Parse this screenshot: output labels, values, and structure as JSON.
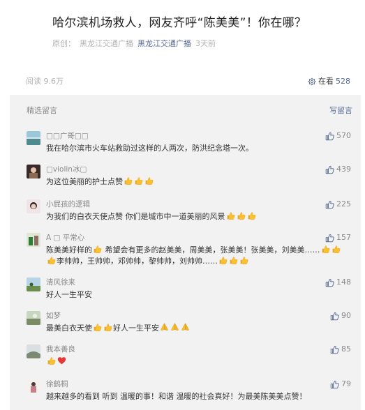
{
  "article": {
    "title": "哈尔滨机场救人，网友齐呼“陈美美”！你在哪？",
    "origin_label": "原创：",
    "author": "黑龙江交通广播",
    "account": "黑龙江交通广播",
    "time": "3天前"
  },
  "stats": {
    "read": "阅读  9.6万",
    "look_label": "在看",
    "look_count": "528"
  },
  "comments_section": {
    "title": "精选留言",
    "write": "写留言"
  },
  "comments": [
    {
      "nick": "□□广哥□□",
      "text": "我在哈尔滨市火车站救助过这样的人两次，防洪纪念塔一次。",
      "likes": "570"
    },
    {
      "nick": "□violin冰□",
      "text": "为这位美丽的护士点赞",
      "likes": "439"
    },
    {
      "nick": "小屁孩的逻辑",
      "text": "为我们的白衣天使点赞 你们是城市中一道美丽的风景",
      "likes": "225"
    },
    {
      "nick": "A □ 平常心",
      "text1": "陈美美好样的",
      "text2": " 希望会有更多的赵美美，周美美，张美美！张美美，刘美美……",
      "text3": "李帅帅，王帅帅，邓帅帅，黎帅帅，刘帅帅……",
      "likes": "157"
    },
    {
      "nick": "清风徐来",
      "text": "好人一生平安",
      "likes": "148"
    },
    {
      "nick": "如梦",
      "text1": "最美白衣天使",
      "text2": "好人一生平安",
      "likes": "90"
    },
    {
      "nick": "我本善良",
      "text": "",
      "likes": "85"
    },
    {
      "nick": "徐鹤桐",
      "text": "越来越多的看到 听到 温暖的事！和谐 温暖的社会真好！为最美陈美美点赞！",
      "likes": "79"
    }
  ],
  "icons": {
    "thumb": "thumb-up-icon",
    "emoji": "thumbs-up-emoji",
    "pray": "pray-emoji",
    "heart": "heart-emoji",
    "look": "look-icon"
  },
  "colors": {
    "link": "#576b95",
    "panel": "#f2f2f2",
    "muted": "#b2b2b2"
  }
}
